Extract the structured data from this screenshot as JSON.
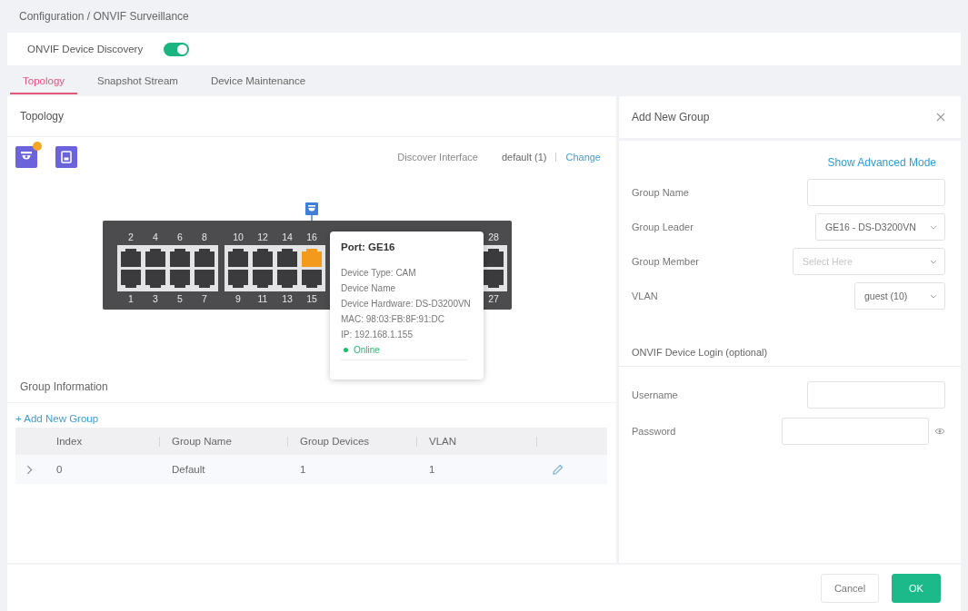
{
  "breadcrumb": "Configuration / ONVIF Surveillance",
  "discovery": {
    "label": "ONVIF Device Discovery",
    "on": true
  },
  "tabs": [
    {
      "label": "Topology",
      "selected": true
    },
    {
      "label": "Snapshot Stream",
      "selected": false
    },
    {
      "label": "Device Maintenance",
      "selected": false
    }
  ],
  "topology": {
    "title": "Topology",
    "tools": [
      {
        "kind": "camera",
        "badge": true
      },
      {
        "kind": "save",
        "badge": false
      }
    ],
    "discover_label": "Discover Interface",
    "discover_value": "default (1)",
    "change_link": "Change",
    "switch": {
      "port_groups": [
        {
          "columns": [
            {
              "top": {
                "label": "2",
                "linked": false
              },
              "bottom": {
                "label": "1",
                "linked": false
              }
            },
            {
              "top": {
                "label": "4",
                "linked": false
              },
              "bottom": {
                "label": "3",
                "linked": false
              }
            },
            {
              "top": {
                "label": "6",
                "linked": false
              },
              "bottom": {
                "label": "5",
                "linked": false
              }
            },
            {
              "top": {
                "label": "8",
                "linked": false
              },
              "bottom": {
                "label": "7",
                "linked": false
              }
            }
          ]
        },
        {
          "columns": [
            {
              "top": {
                "label": "10",
                "linked": false
              },
              "bottom": {
                "label": "9",
                "linked": false
              }
            },
            {
              "top": {
                "label": "12",
                "linked": false
              },
              "bottom": {
                "label": "11",
                "linked": false
              }
            },
            {
              "top": {
                "label": "14",
                "linked": false
              },
              "bottom": {
                "label": "13",
                "linked": false
              }
            },
            {
              "top": {
                "label": "16",
                "linked": true
              },
              "bottom": {
                "label": "15",
                "linked": false
              }
            }
          ]
        },
        {
          "columns": [
            {
              "top": {
                "label": "28",
                "linked": false
              },
              "bottom": {
                "label": "27",
                "linked": false
              }
            }
          ]
        }
      ]
    },
    "tooltip": {
      "title": "Port: GE16",
      "lines": [
        "Device Type: CAM",
        "Device Name",
        "Device Hardware: DS-D3200VN",
        "MAC: 98:03:FB:8F:91:DC",
        "IP: 192.168.1.155"
      ],
      "status": "Online",
      "online": true
    }
  },
  "group_info": {
    "title": "Group Information",
    "add_link": "+ Add New Group",
    "table": {
      "columns": [
        "Index",
        "Group Name",
        "Group Devices",
        "VLAN"
      ],
      "rows": [
        {
          "expanded": false,
          "cells": [
            "0",
            "Default",
            "1",
            "1"
          ]
        }
      ]
    }
  },
  "dialog": {
    "title": "Add New Group",
    "advanced_link": "Show Advanced Mode",
    "fields": [
      {
        "kind": "input",
        "label": "Group Name"
      },
      {
        "kind": "select",
        "label": "Group Leader",
        "value": "GE16 - DS-D3200VN"
      },
      {
        "kind": "select",
        "label": "Group Member",
        "placeholder": "Select Here"
      },
      {
        "kind": "select",
        "label": "VLAN",
        "value": "guest (10)"
      }
    ],
    "login_title": "ONVIF Device Login (optional)",
    "login_fields": [
      {
        "kind": "input",
        "label": "Username"
      },
      {
        "kind": "password",
        "label": "Password"
      }
    ]
  },
  "footer": {
    "buttons": [
      {
        "kind": "secondary",
        "label": "Cancel"
      },
      {
        "kind": "primary",
        "label": "OK"
      }
    ]
  }
}
